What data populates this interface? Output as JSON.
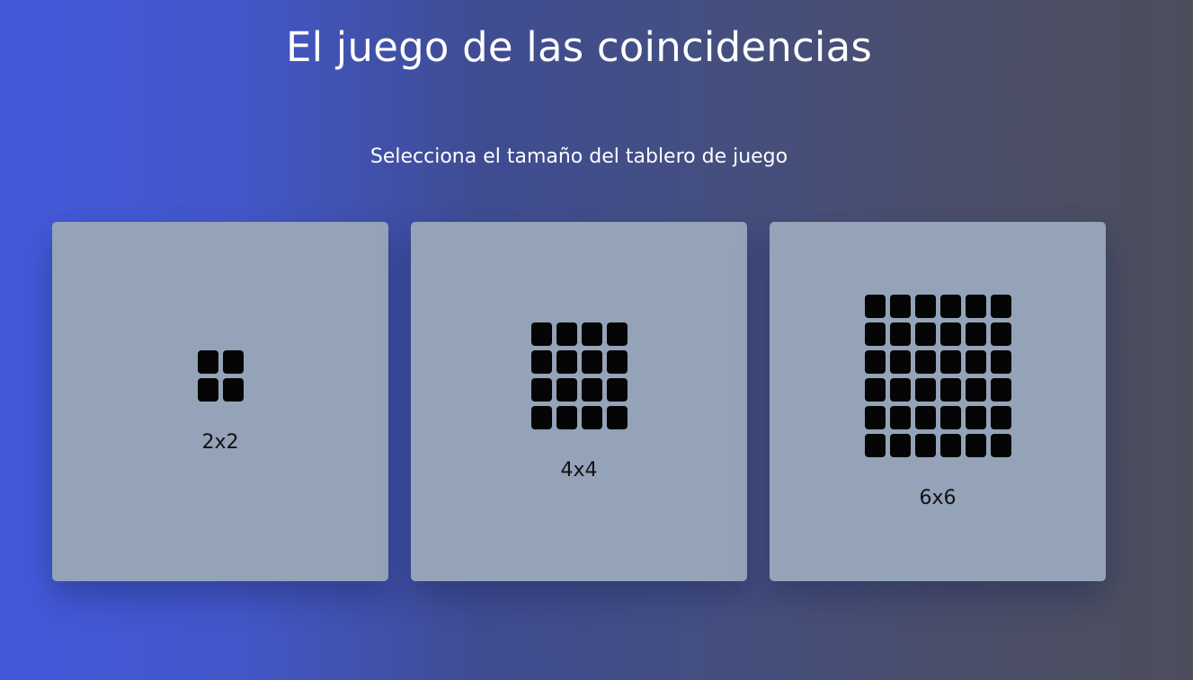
{
  "header": {
    "title": "El juego de las coincidencias",
    "subtitle": "Selecciona el tamaño del tablero de juego"
  },
  "boards": [
    {
      "label": "2x2",
      "size": 2
    },
    {
      "label": "4x4",
      "size": 4
    },
    {
      "label": "6x6",
      "size": 6
    }
  ],
  "colors": {
    "card_background": "#94a3b8",
    "cell": "#050505",
    "gradient_start": "#4359db",
    "gradient_end": "#4d4e5c"
  }
}
